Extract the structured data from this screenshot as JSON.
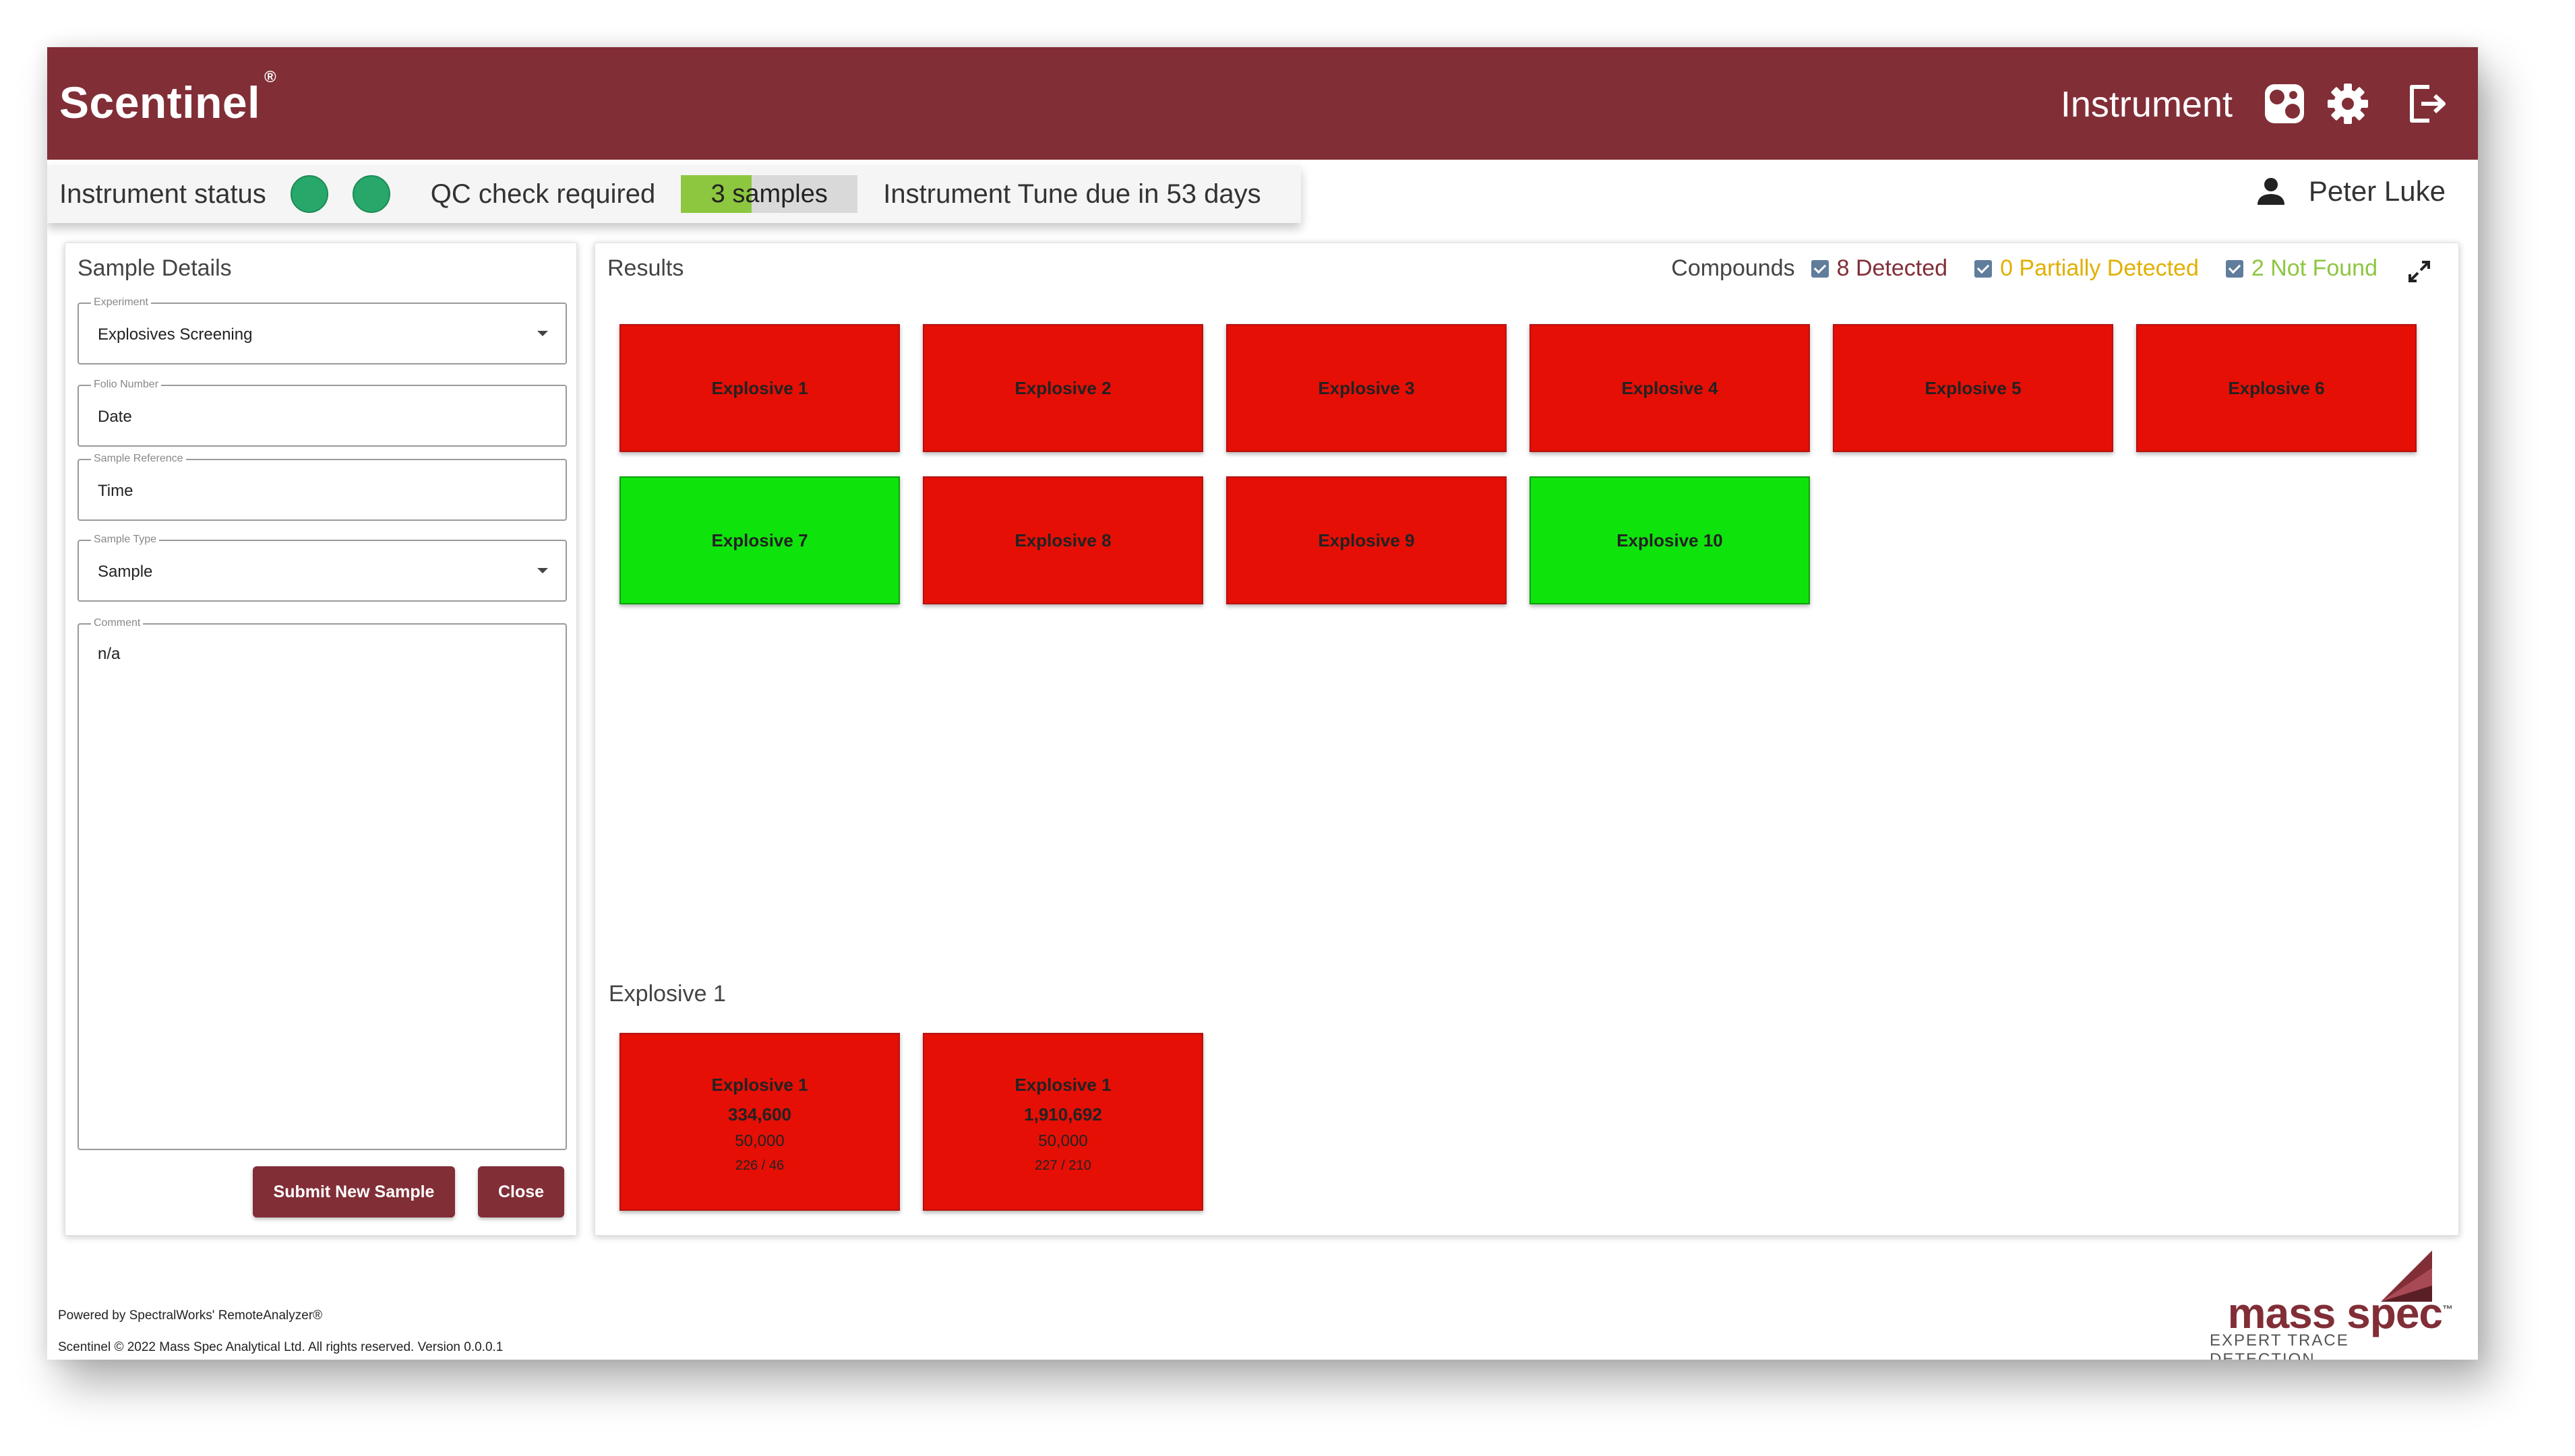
{
  "header": {
    "brand": "Scentinel",
    "brand_mark": "®",
    "title": "Instrument",
    "icons": [
      "instrument-icon",
      "gear-icon",
      "logout-icon"
    ],
    "color": "#812e37"
  },
  "status": {
    "label": "Instrument status",
    "indicators": [
      "ok",
      "ok"
    ],
    "indicator_color": "#27a86a",
    "qc_text": "QC check required",
    "qc_progress_label": "3 samples",
    "qc_progress_fraction": 0.4,
    "tune_text": "Instrument Tune due in 53 days"
  },
  "user": {
    "name": "Peter Luke",
    "icon": "user-icon"
  },
  "sample_details": {
    "title": "Sample Details",
    "fields": [
      {
        "label": "Experiment",
        "value": "Explosives Screening",
        "type": "select"
      },
      {
        "label": "Folio Number",
        "value": "Date",
        "type": "text"
      },
      {
        "label": "Sample Reference",
        "value": "Time",
        "type": "text"
      },
      {
        "label": "Sample Type",
        "value": "Sample",
        "type": "select"
      },
      {
        "label": "Comment",
        "value": "n/a",
        "type": "textarea"
      }
    ],
    "submit_label": "Submit New Sample",
    "close_label": "Close"
  },
  "results": {
    "title": "Results",
    "compounds_label": "Compounds",
    "legend": [
      {
        "label": "8 Detected",
        "color": "#812e37",
        "checked": true
      },
      {
        "label": "0 Partially Detected",
        "color": "#e0b000",
        "checked": true
      },
      {
        "label": "2 Not Found",
        "color": "#8dc63f",
        "checked": true
      }
    ],
    "expand_icon": "expand-icon",
    "tiles": [
      {
        "name": "Explosive 1",
        "status": "detected"
      },
      {
        "name": "Explosive 2",
        "status": "detected"
      },
      {
        "name": "Explosive 3",
        "status": "detected"
      },
      {
        "name": "Explosive 4",
        "status": "detected"
      },
      {
        "name": "Explosive 5",
        "status": "detected"
      },
      {
        "name": "Explosive 6",
        "status": "detected"
      },
      {
        "name": "Explosive 7",
        "status": "not-found"
      },
      {
        "name": "Explosive 8",
        "status": "detected"
      },
      {
        "name": "Explosive 9",
        "status": "detected"
      },
      {
        "name": "Explosive 10",
        "status": "not-found"
      }
    ],
    "status_colors": {
      "detected": "#e50f05",
      "not-found": "#0fe30c"
    },
    "detail": {
      "title": "Explosive 1",
      "tiles": [
        {
          "name": "Explosive 1",
          "value": "334,600",
          "threshold": "50,000",
          "ratio": "226 / 46"
        },
        {
          "name": "Explosive 1",
          "value": "1,910,692",
          "threshold": "50,000",
          "ratio": "227 / 210"
        }
      ]
    }
  },
  "footer": {
    "powered_by": "Powered by SpectralWorks' RemoteAnalyzer®",
    "copyright": "Scentinel © 2022 Mass Spec Analytical Ltd. All rights reserved. Version 0.0.0.1",
    "logo_text": "mass spec",
    "logo_tm": "™",
    "logo_tagline": "EXPERT TRACE DETECTION"
  }
}
